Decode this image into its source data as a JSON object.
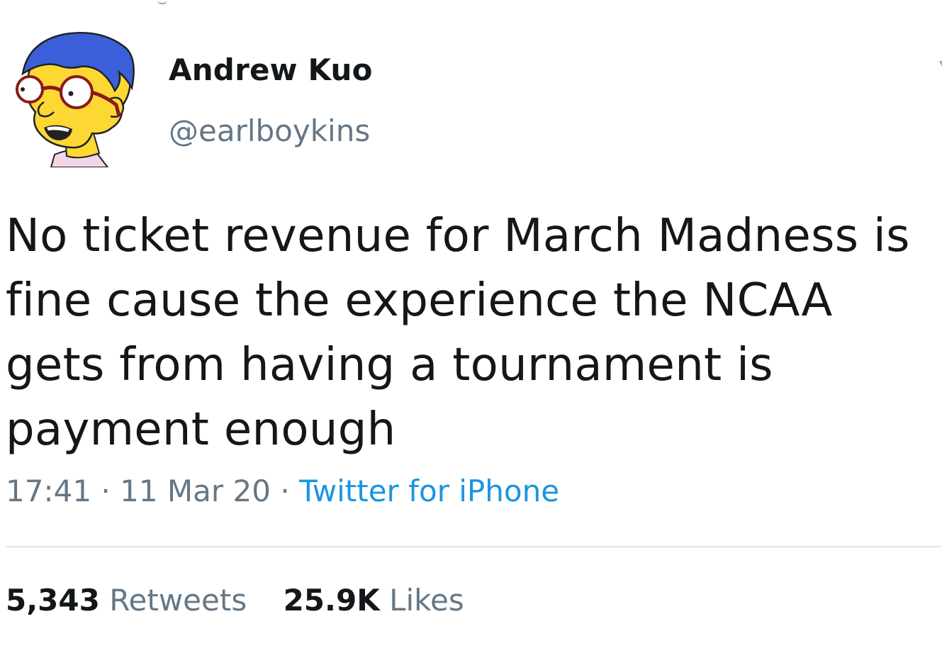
{
  "user": {
    "display_name": "Andrew Kuo",
    "handle": "@earlboykins",
    "avatar_icon": "cartoon-avatar-icon"
  },
  "tweet": {
    "text": "No ticket revenue for March Madness is fine cause the experience the NCAA gets from having a tournament is payment enough"
  },
  "meta": {
    "time": "17:41",
    "separator": "·",
    "date": "11 Mar 20",
    "source": "Twitter for iPhone"
  },
  "stats": {
    "retweets_count": "5,343",
    "retweets_label": "Retweets",
    "likes_count": "25.9K",
    "likes_label": "Likes"
  },
  "colors": {
    "text_primary": "#14171a",
    "text_secondary": "#657786",
    "link": "#1b95e0",
    "divider": "#e1e8ed"
  }
}
